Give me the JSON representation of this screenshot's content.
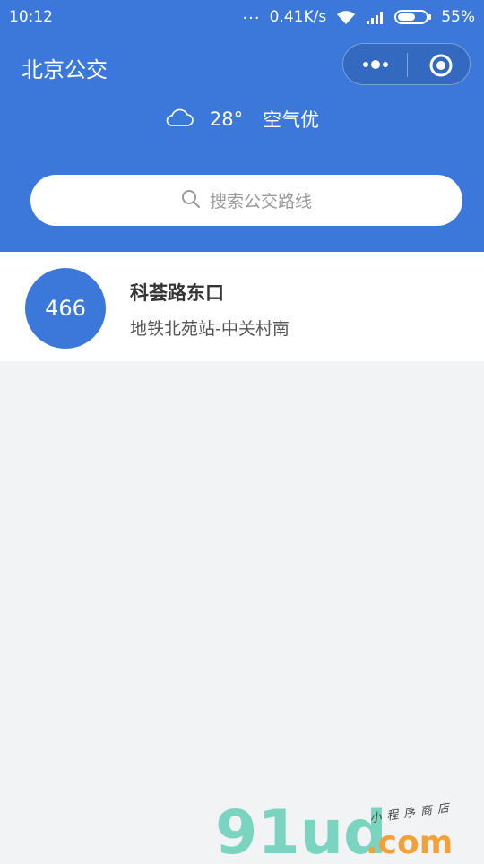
{
  "status_bar": {
    "time": "10:12",
    "dots": "...",
    "network_speed": "0.41K/s",
    "battery": "55%",
    "icons": [
      "wifi-icon",
      "signal-icon",
      "battery-icon"
    ]
  },
  "header": {
    "title": "北京公交",
    "capsule_icons": [
      "more-icon",
      "close-target-icon"
    ]
  },
  "weather": {
    "icon": "cloud-icon",
    "temperature": "28°",
    "air_quality": "空气优"
  },
  "search": {
    "icon": "search-icon",
    "placeholder": "搜索公交路线"
  },
  "routes": [
    {
      "number": "466",
      "stop_name": "科荟路东口",
      "direction": "地铁北苑站-中关村南"
    }
  ],
  "watermark": {
    "logo_text": "91ud.com",
    "tagline": "小程序商店"
  },
  "colors": {
    "primary": "#3b78d9",
    "background": "#f2f3f5"
  }
}
